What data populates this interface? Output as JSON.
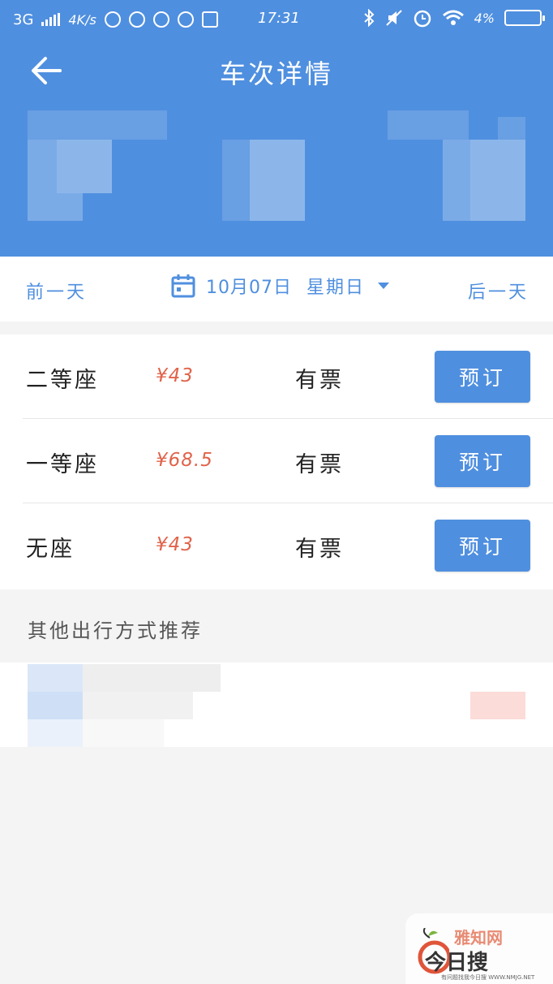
{
  "status_bar": {
    "network": "3G",
    "speed": "4K/s",
    "time": "17:31",
    "battery": "4%"
  },
  "header": {
    "title": "车次详情"
  },
  "date_bar": {
    "prev_label": "前一天",
    "date": "10月07日",
    "weekday": "星期日",
    "next_label": "后一天"
  },
  "seats": [
    {
      "name": "二等座",
      "price": "¥43",
      "availability": "有票",
      "button": "预订"
    },
    {
      "name": "一等座",
      "price": "¥68.5",
      "availability": "有票",
      "button": "预订"
    },
    {
      "name": "无座",
      "price": "¥43",
      "availability": "有票",
      "button": "预订"
    }
  ],
  "other_travel": {
    "title": "其他出行方式推荐"
  },
  "watermark": {
    "line1": "雅知网",
    "line2": "今日搜",
    "line3": "有问题找我今日搜 WWW.NMJG.NET"
  },
  "colors": {
    "primary": "#4f8fdf",
    "price": "#e0634a",
    "background": "#f4f4f4"
  }
}
